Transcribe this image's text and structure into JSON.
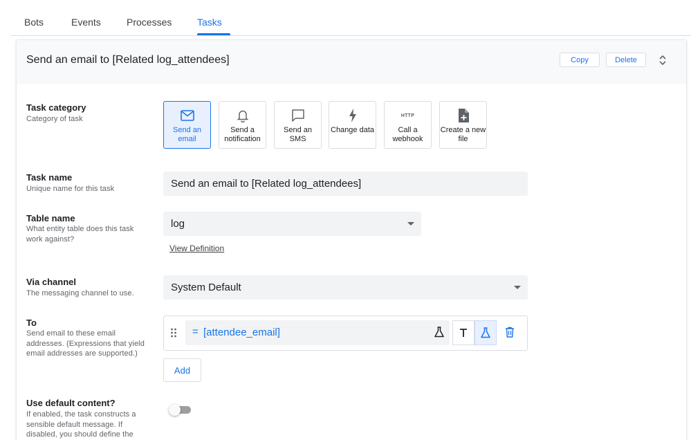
{
  "tabs": [
    {
      "label": "Bots"
    },
    {
      "label": "Events"
    },
    {
      "label": "Processes"
    },
    {
      "label": "Tasks"
    }
  ],
  "active_tab": "Tasks",
  "header": {
    "title": "Send an email to [Related log_attendees]",
    "copy_label": "Copy",
    "delete_label": "Delete"
  },
  "task_category": {
    "label": "Task category",
    "sublabel": "Category of task",
    "selected": "email",
    "options": [
      {
        "label": "Send an email",
        "icon": "mail-icon"
      },
      {
        "label": "Send a notification",
        "icon": "bell-icon"
      },
      {
        "label": "Send an SMS",
        "icon": "chat-bubble-icon"
      },
      {
        "label": "Change data",
        "icon": "lightning-icon"
      },
      {
        "label": "Call a webhook",
        "icon": "http-icon",
        "icon_text": "HTTP"
      },
      {
        "label": "Create a new file",
        "icon": "add-file-icon"
      }
    ]
  },
  "task_name": {
    "label": "Task name",
    "sublabel": "Unique name for this task",
    "value": "Send an email to [Related log_attendees]"
  },
  "table_name": {
    "label": "Table name",
    "sublabel": "What entity table does this task work against?",
    "value": "log",
    "view_definition": "View Definition"
  },
  "via_channel": {
    "label": "Via channel",
    "sublabel": "The messaging channel to use.",
    "value": "System Default"
  },
  "to": {
    "label": "To",
    "sublabel": "Send email to these email addresses. (Expressions that yield email addresses are supported.)",
    "items": [
      {
        "prefix": "=",
        "value": "[attendee_email]"
      }
    ],
    "add_label": "Add"
  },
  "use_default_content": {
    "label": "Use default content?",
    "sublabel": "If enabled, the task constructs a sensible default message. If disabled, you should define the",
    "enabled": false
  },
  "colors": {
    "accent": "#1a73e8",
    "selected_bg": "#e8f0fe",
    "field_bg": "#f1f3f4",
    "header_bg": "#f8f9fa"
  }
}
